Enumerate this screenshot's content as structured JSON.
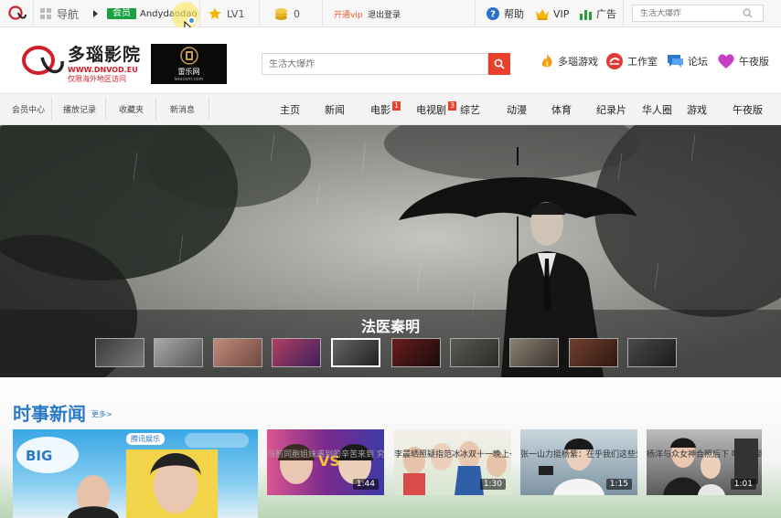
{
  "topbar": {
    "nav_label": "导航",
    "member_badge": "会员",
    "username": "Andydaodao",
    "level": "LV1",
    "coins": "0",
    "vip_open": "开通vip",
    "logout": "退出登录",
    "help": "帮助",
    "vip": "VIP",
    "ads": "广告",
    "search_placeholder": "生活大爆炸"
  },
  "brand": {
    "name": "多瑙影院",
    "url": "WWW.DNVOD.EU",
    "note": "仅限海外地区访问",
    "partner_name": "雷乐网",
    "partner_url": "leiecom.com"
  },
  "header": {
    "search_placeholder": "生活大爆炸",
    "links": [
      "多瑙游戏",
      "工作室",
      "论坛",
      "午夜版"
    ]
  },
  "nav_left": [
    "会员中心",
    "播放记录",
    "收藏夹",
    "新消息"
  ],
  "nav_main": [
    {
      "label": "主页",
      "badge": ""
    },
    {
      "label": "新闻",
      "badge": ""
    },
    {
      "label": "电影",
      "badge": "1"
    },
    {
      "label": "电视剧",
      "badge": "3"
    },
    {
      "label": "综艺",
      "badge": ""
    },
    {
      "label": "动漫",
      "badge": ""
    },
    {
      "label": "体育",
      "badge": ""
    },
    {
      "label": "纪录片",
      "badge": ""
    },
    {
      "label": "华人圈",
      "badge": ""
    },
    {
      "label": "游戏",
      "badge": ""
    },
    {
      "label": "午夜版",
      "badge": ""
    }
  ],
  "banner": {
    "caption": "法医秦明",
    "active_thumb_index": 4
  },
  "news": {
    "title": "时事新闻",
    "more": "更多>",
    "cards": [
      {
        "duration": "",
        "title": "",
        "brand": "腾讯娱乐"
      },
      {
        "duration": "1:44",
        "title": "与前同胞姐妹遇到的辛苦来到 究之事后",
        "faded": true
      },
      {
        "duration": "1:30",
        "title": "李晨晒照疑指范冰冰双十一晚上一致家 网"
      },
      {
        "duration": "1:15",
        "title": "张一山力挺杨紫：在乎我们这些爱"
      },
      {
        "duration": "1:01",
        "title": "杨洋与众女神合照后下 唯我遇到天"
      }
    ]
  },
  "colors": {
    "accent_red": "#e8402d",
    "member_green": "#1aa142",
    "news_blue": "#2b7ac8",
    "brand_red": "#d2202a"
  }
}
